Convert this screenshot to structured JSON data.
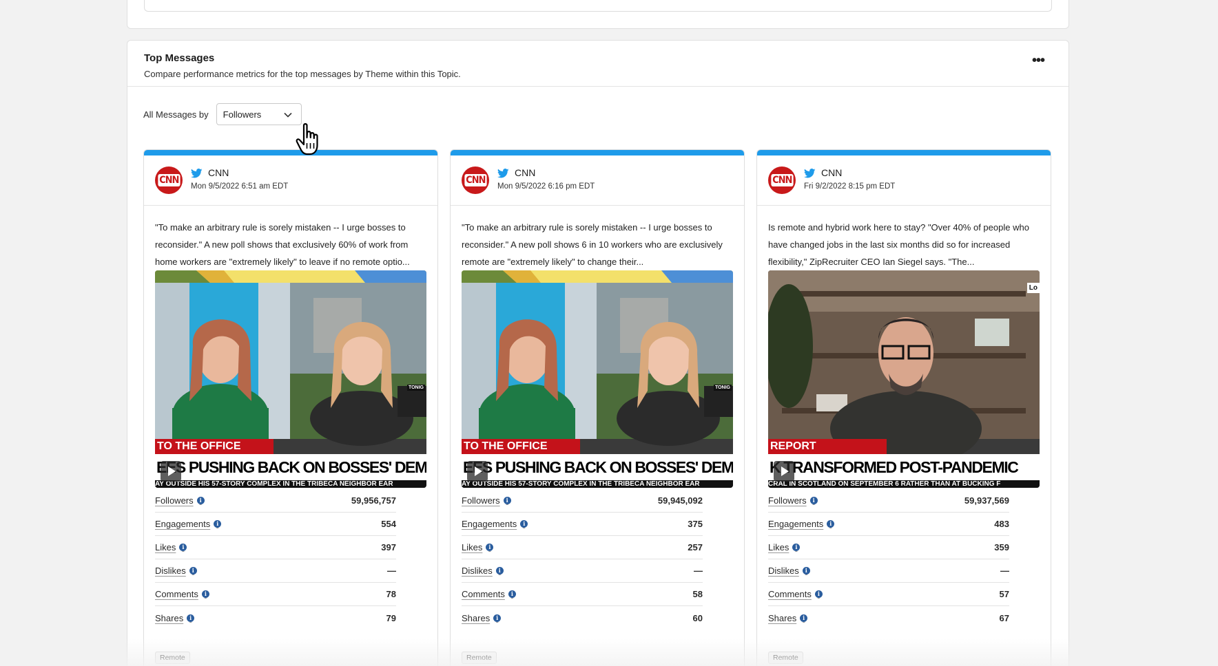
{
  "panel": {
    "title": "Top Messages",
    "subtitle": "Compare performance metrics for the top messages by Theme within this Topic.",
    "more_icon": "more-horizontal-icon",
    "more_glyph": "•••"
  },
  "filter": {
    "label": "All Messages by",
    "selected": "Followers"
  },
  "cards": [
    {
      "author": "CNN",
      "avatar_text": "CNN",
      "date": "Mon 9/5/2022 6:51 am EDT",
      "message": "\"To make an arbitrary rule is sorely mistaken -- I urge bosses to reconsider.\" A new poll shows that exclusively 60% of work from home workers are \"extremely likely\" to leave if no remote optio...",
      "video": {
        "lower_third": "TO THE OFFICE",
        "headline": "EES PUSHING BACK ON BOSSES' DEMANDS TO RETURN TO OFFICE",
        "ticker": "AY OUTSIDE HIS 57-STORY COMPLEX IN THE TRIBECA NEIGHBOR  EAR",
        "tag": "TONIG"
      },
      "metrics": [
        {
          "label": "Followers",
          "value": "59,956,757"
        },
        {
          "label": "Engagements",
          "value": "554"
        },
        {
          "label": "Likes",
          "value": "397"
        },
        {
          "label": "Dislikes",
          "value": "—"
        },
        {
          "label": "Comments",
          "value": "78"
        },
        {
          "label": "Shares",
          "value": "79"
        }
      ],
      "tag": "Remote"
    },
    {
      "author": "CNN",
      "avatar_text": "CNN",
      "date": "Mon 9/5/2022 6:16 pm EDT",
      "message": "\"To make an arbitrary rule is sorely mistaken -- I urge bosses to reconsider.\" A new poll shows 6 in 10 workers who are exclusively remote are \"extremely likely\" to change their...",
      "video": {
        "lower_third": "TO THE OFFICE",
        "headline": "EES PUSHING BACK ON BOSSES' DEMANDS TO RETURN TO OFFICE",
        "ticker": "AY OUTSIDE HIS 57-STORY COMPLEX IN THE TRIBECA NEIGHBOR  EAR",
        "tag": "TONIG"
      },
      "metrics": [
        {
          "label": "Followers",
          "value": "59,945,092"
        },
        {
          "label": "Engagements",
          "value": "375"
        },
        {
          "label": "Likes",
          "value": "257"
        },
        {
          "label": "Dislikes",
          "value": "—"
        },
        {
          "label": "Comments",
          "value": "58"
        },
        {
          "label": "Shares",
          "value": "60"
        }
      ],
      "tag": "Remote"
    },
    {
      "author": "CNN",
      "avatar_text": "CNN",
      "date": "Fri 9/2/2022 8:15 pm EDT",
      "message": "Is remote and hybrid work here to stay? \"Over 40% of people who have changed jobs in the last six months did so for increased flexibility,\" ZipRecruiter CEO Ian Siegel says. \"The...",
      "video": {
        "lower_third": "REPORT",
        "headline": "K TRANSFORMED POST-PANDEMIC",
        "ticker": "CRAL IN SCOTLAND ON SEPTEMBER 6 RATHER THAN AT BUCKING  F",
        "tag": "Lo"
      },
      "metrics": [
        {
          "label": "Followers",
          "value": "59,937,569"
        },
        {
          "label": "Engagements",
          "value": "483"
        },
        {
          "label": "Likes",
          "value": "359"
        },
        {
          "label": "Dislikes",
          "value": "—"
        },
        {
          "label": "Comments",
          "value": "57"
        },
        {
          "label": "Shares",
          "value": "67"
        }
      ],
      "tag": "Remote"
    }
  ],
  "colors": {
    "twitter_blue": "#1e9bea",
    "cnn_red": "#c8191a",
    "info_blue": "#2a5d9e"
  }
}
